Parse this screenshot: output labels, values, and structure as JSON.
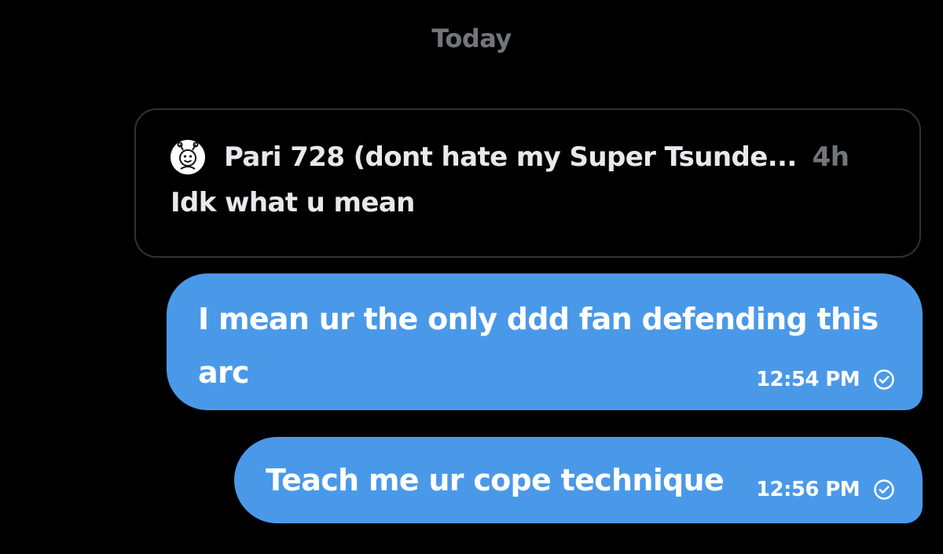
{
  "day_separator": "Today",
  "reply_preview": {
    "author": "Pari 728 (dont hate my Super Tsunde...",
    "time": "4h",
    "text": "Idk what u mean",
    "avatar_icon": "smiling-robot-avatar-icon"
  },
  "messages": [
    {
      "text": "I mean ur the only ddd fan defending this arc",
      "time": "12:54 PM",
      "status_icon": "check-circle-icon"
    },
    {
      "text": "Teach me ur cope technique",
      "time": "12:56 PM",
      "status_icon": "check-circle-icon"
    }
  ],
  "colors": {
    "background": "#000000",
    "bubble": "#4a99e9",
    "secondary_text": "#71767b",
    "primary_text": "#e7e9ea",
    "preview_border": "#2f3336"
  }
}
